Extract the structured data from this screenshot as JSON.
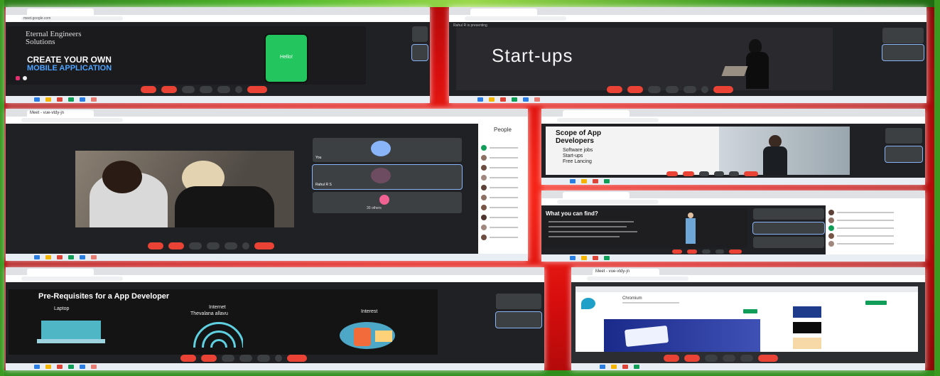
{
  "shots": {
    "s1": {
      "url": "meet.google.com",
      "company": "Eternal Engineers\nSolutions",
      "tagline": "CREATE YOUR OWN",
      "tagline2": "MOBILE APPLICATION",
      "phone_text": "Hello!"
    },
    "s2": {
      "recording": "Rahul R is presenting",
      "slide_title": "Start-ups"
    },
    "s3": {
      "tab": "Meet - vue-vtdy-jn",
      "people_header": "People",
      "tile1": "You",
      "tile2": "Rahul R S",
      "others": "30 others"
    },
    "s4": {
      "slide_title": "Scope of App Developers",
      "bullets": [
        "Software jobs",
        "Start-ups",
        "Free Lancing"
      ]
    },
    "s5": {
      "slide_title": "What you can find?"
    },
    "s6": {
      "slide_title": "Pre-Requisites for a App Developer",
      "col1": "Laptop",
      "col2": "Internet",
      "col2b": "Thevalana allavu",
      "col3": "Interest"
    },
    "s7": {
      "tab": "Meet - vue-vtdy-jn",
      "app_name": "Chromium"
    }
  },
  "colors": {
    "bg_red": "#e0120f",
    "meet_dark": "#202124",
    "hangup": "#ea4335",
    "phone_green": "#22c55e"
  }
}
